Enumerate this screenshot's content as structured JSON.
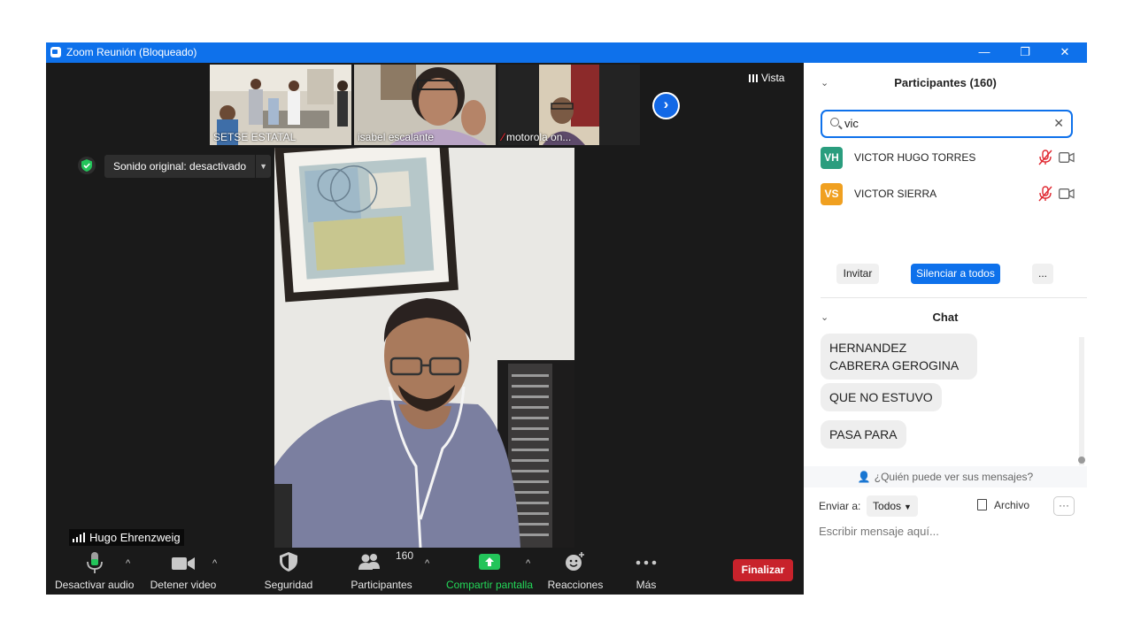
{
  "window": {
    "title": "Zoom Reunión (Bloqueado)",
    "controls": {
      "minimize": "—",
      "restore": "❐",
      "close": "✕"
    }
  },
  "thumbnails": [
    {
      "name": "SETSE ESTATAL",
      "muted": false
    },
    {
      "name": "isabel escalante",
      "muted": false
    },
    {
      "name": "motorola on...",
      "muted": true
    }
  ],
  "view_button": {
    "label": "Vista",
    "icon": "grid-icon"
  },
  "sound_pill": {
    "label": "Sonido original: desactivado",
    "icon": "shield-check-icon"
  },
  "active_speaker": {
    "name": "Hugo Ehrenzweig",
    "icon": "signal-bars-icon"
  },
  "toolbar": {
    "mute": "Desactivar audio",
    "video": "Detener video",
    "security": "Seguridad",
    "participants": "Participantes",
    "participants_count": "160",
    "share": "Compartir pantalla",
    "reactions": "Reacciones",
    "more": "Más",
    "end": "Finalizar",
    "chevron": "^"
  },
  "participants_panel": {
    "title": "Participantes (160)",
    "search_value": "vic",
    "results": [
      {
        "initials": "VH",
        "name": "VICTOR HUGO TORRES",
        "avatar_color": "#2a9d7e"
      },
      {
        "initials": "VS",
        "name": "VICTOR SIERRA",
        "avatar_color": "#f0a020"
      }
    ],
    "buttons": {
      "invite": "Invitar",
      "mute_all": "Silenciar a todos",
      "more": "..."
    }
  },
  "chat_panel": {
    "title": "Chat",
    "messages": [
      "HERNANDEZ CABRERA GEROGINA",
      "QUE NO ESTUVO",
      "PASA PARA"
    ],
    "who_can_see": "¿Quién puede ver sus mensajes?",
    "send_to_label": "Enviar a:",
    "send_to_value": "Todos",
    "file_label": "Archivo",
    "more": "···",
    "input_placeholder": "Escribir mensaje aquí..."
  },
  "colors": {
    "titlebar": "#0e71eb",
    "meeting_bg": "#1a1a1a",
    "share_green": "#23d959",
    "end_red": "#c8222b",
    "accent_blue": "#0e71eb",
    "mute_red": "#e0262f"
  }
}
